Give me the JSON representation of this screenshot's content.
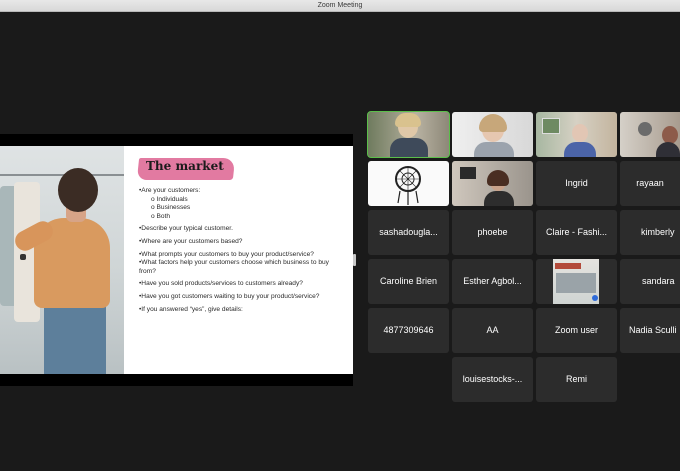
{
  "window": {
    "title": "Zoom Meeting"
  },
  "slide": {
    "title": "The market",
    "q1": "•Are your customers:",
    "options": [
      "o   Individuals",
      "o   Businesses",
      "o   Both"
    ],
    "q2": "•Describe your typical customer.",
    "q3": "•Where are your customers based?",
    "q4": "•What prompts your customers to buy your product/service?",
    "q5": "•What factors help your customers choose which business to buy from?",
    "q6": "•Have you sold products/services to customers already?",
    "q7": "•Have you got customers waiting to buy your product/service?",
    "q8": "•If you answered “yes”, give details:"
  },
  "participants": {
    "ingrid": "Ingrid",
    "rayaan": "rayaan",
    "sashadougla": "sashadougla...",
    "phoebe": "phoebe",
    "claire": "Claire - Fashi...",
    "kimberly": "kimberly",
    "caroline": "Caroline Brien",
    "esther": "Esther Agbol...",
    "sandara": "sandara",
    "num": "4877309646",
    "aa": "AA",
    "zoom_user": "Zoom user",
    "nadia": "Nadia Sculli",
    "louise": "louisestocks-...",
    "remi": "Remi"
  },
  "colors": {
    "active_speaker": "#5bbf4a",
    "banner": "#e27aa1",
    "tile_bg": "#2c2c2c"
  }
}
